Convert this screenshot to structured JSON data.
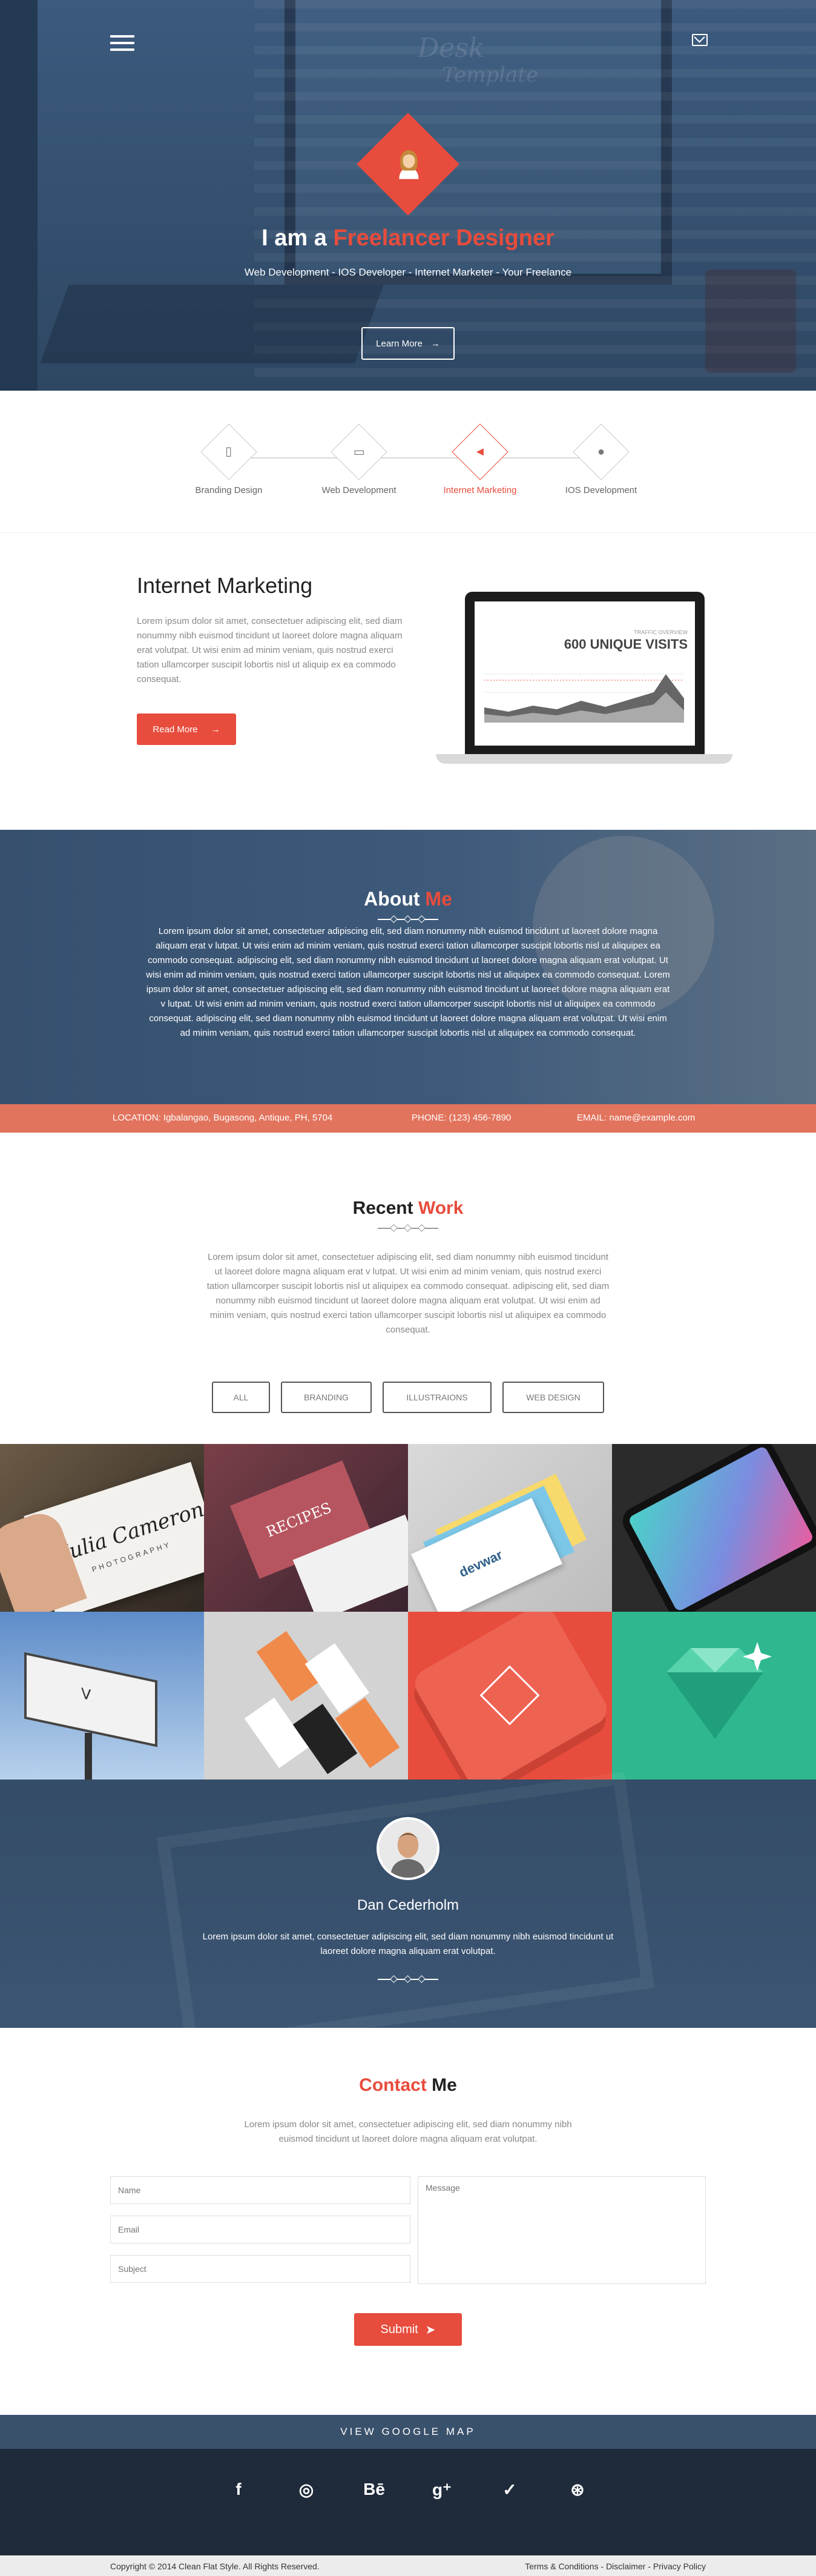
{
  "hero": {
    "watermark_line1": "Desk",
    "watermark_line2": "Template",
    "title_prefix": "I am a ",
    "title_accent": "Freelancer Designer",
    "subtitle": "Web Development - IOS Developer - Internet Marketer - Your Freelance",
    "learn_more": "Learn More",
    "menu_icon": "hamburger-icon",
    "mail_icon": "envelope-icon",
    "accent_color": "#e74c3c"
  },
  "services": [
    {
      "label": "Branding Design",
      "icon": "mobile-icon",
      "glyph": "▯"
    },
    {
      "label": "Web Development",
      "icon": "monitor-icon",
      "glyph": "▭"
    },
    {
      "label": "Internet Marketing",
      "icon": "megaphone-icon",
      "glyph": "◄"
    },
    {
      "label": "IOS Development",
      "icon": "apple-icon",
      "glyph": "●"
    }
  ],
  "internet_marketing": {
    "title": "Internet Marketing",
    "text": "Lorem ipsum dolor sit amet, consectetuer adipiscing elit, sed diam nonummy nibh euismod tincidunt ut laoreet dolore magna aliquam erat volutpat. Ut wisi enim ad minim veniam, quis nostrud exerci tation ullamcorper suscipit lobortis nisl ut aliquip ex ea commodo consequat.",
    "read_more": "Read More",
    "screen_label": "TRAFFIC OVERVIEW",
    "screen_value": "600 UNIQUE VISITS"
  },
  "about": {
    "title_prefix": "About ",
    "title_accent": "Me",
    "text": "Lorem ipsum dolor sit amet, consectetuer adipiscing elit, sed diam nonummy nibh euismod tincidunt ut laoreet dolore magna aliquam erat v lutpat. Ut wisi enim ad minim veniam, quis nostrud exerci tation ullamcorper suscipit lobortis nisl ut aliquipex ea commodo consequat. adipiscing elit, sed diam nonummy nibh euismod tincidunt ut laoreet dolore magna aliquam erat volutpat. Ut wisi enim ad minim veniam, quis nostrud exerci tation ullamcorper suscipit lobortis nisl ut aliquipex ea commodo consequat. Lorem ipsum dolor sit amet, consectetuer adipiscing elit, sed diam nonummy nibh euismod tincidunt ut laoreet dolore magna aliquam erat v lutpat. Ut wisi enim ad minim veniam, quis nostrud exerci tation ullamcorper suscipit lobortis nisl ut aliquipex ea commodo consequat. adipiscing elit, sed diam nonummy nibh euismod tincidunt ut laoreet dolore magna aliquam erat volutpat. Ut wisi enim ad minim veniam, quis nostrud exerci tation ullamcorper suscipit lobortis nisl ut aliquipex ea commodo consequat.",
    "location": "LOCATION: Igbalangao, Bugasong, Antique, PH, 5704",
    "phone": "PHONE: (123) 456-7890",
    "email": "EMAIL: name@example.com"
  },
  "recent_work": {
    "title_prefix": "Recent ",
    "title_accent": "Work",
    "text": "Lorem ipsum dolor sit amet, consectetuer adipiscing elit, sed diam nonummy nibh euismod tincidunt ut laoreet dolore magna aliquam erat v lutpat. Ut wisi enim ad minim veniam, quis nostrud exerci tation ullamcorper suscipit lobortis nisl ut aliquipex ea commodo consequat. adipiscing elit, sed diam nonummy nibh euismod tincidunt ut laoreet dolore magna aliquam erat volutpat. Ut wisi enim ad minim veniam, quis nostrud exerci tation ullamcorper suscipit lobortis nisl ut aliquipex ea commodo consequat.",
    "filters": [
      "ALL",
      "BRANDING",
      "ILLUSTRAIONS",
      "WEB DESIGN"
    ],
    "portfolio_card_text": "Julia Cameron",
    "portfolio_card_sub": "PHOTOGRAPHY",
    "recipes_text": "RECIPES",
    "devwar_text": "devwar"
  },
  "testimonial": {
    "name": "Dan Cederholm",
    "text": "Lorem ipsum dolor sit amet, consectetuer adipiscing elit, sed diam nonummy nibh euismod tincidunt ut laoreet dolore magna aliquam erat volutpat."
  },
  "contact": {
    "title_prefix": "Contact ",
    "title_accent": "Me",
    "text": "Lorem ipsum dolor sit amet, consectetuer adipiscing elit, sed diam nonummy nibh euismod tincidunt ut laoreet dolore magna aliquam erat volutpat.",
    "name_placeholder": "Name",
    "email_placeholder": "Email",
    "subject_placeholder": "Subject",
    "message_placeholder": "Message",
    "submit": "Submit"
  },
  "map": {
    "label": "VIEW GOOGLE MAP"
  },
  "social": [
    {
      "icon": "facebook-icon",
      "glyph": "f"
    },
    {
      "icon": "instagram-icon",
      "glyph": "◎"
    },
    {
      "icon": "behance-icon",
      "glyph": "Bē"
    },
    {
      "icon": "google-plus-icon",
      "glyph": "g⁺"
    },
    {
      "icon": "twitter-icon",
      "glyph": "✓"
    },
    {
      "icon": "dribbble-icon",
      "glyph": "⊛"
    }
  ],
  "footer": {
    "copyright": "Copyright © 2014 Clean Flat Style. All Rights Reserved.",
    "terms": "Terms & Conditions",
    "disclaimer": "Disclaimer",
    "privacy": "Privacy Policy",
    "separator": " - "
  }
}
